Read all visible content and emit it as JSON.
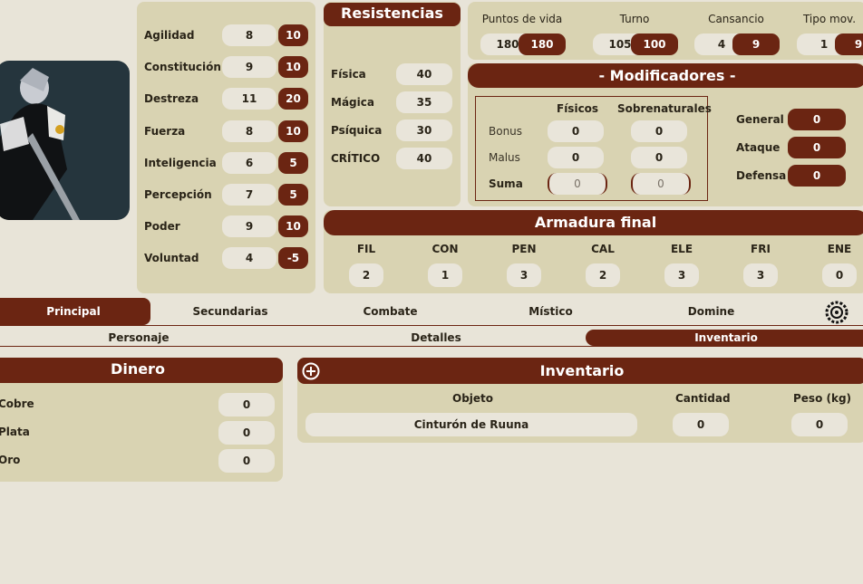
{
  "stats": [
    {
      "name": "Agilidad",
      "base": "8",
      "value": "10"
    },
    {
      "name": "Constitución",
      "base": "9",
      "value": "10"
    },
    {
      "name": "Destreza",
      "base": "11",
      "value": "20"
    },
    {
      "name": "Fuerza",
      "base": "8",
      "value": "10"
    },
    {
      "name": "Inteligencia",
      "base": "6",
      "value": "5"
    },
    {
      "name": "Percepción",
      "base": "7",
      "value": "5"
    },
    {
      "name": "Poder",
      "base": "9",
      "value": "10"
    },
    {
      "name": "Voluntad",
      "base": "4",
      "value": "-5"
    }
  ],
  "resistencias": {
    "title": "Resistencias",
    "items": [
      {
        "name": "Física",
        "value": "40"
      },
      {
        "name": "Mágica",
        "value": "35"
      },
      {
        "name": "Psíquica",
        "value": "30"
      },
      {
        "name": "CRÍTICO",
        "value": "40"
      }
    ]
  },
  "vitals": [
    {
      "label": "Puntos de vida",
      "current": "180",
      "max": "180"
    },
    {
      "label": "Turno",
      "current": "105",
      "max": "100"
    },
    {
      "label": "Cansancio",
      "current": "4",
      "max": "9"
    },
    {
      "label": "Tipo mov.",
      "current": "1",
      "max": "9"
    }
  ],
  "modificadores": {
    "title": "- Modificadores -",
    "col1": "Físicos",
    "col2": "Sobrenaturales",
    "rows": [
      {
        "label": "Bonus",
        "fis": "0",
        "sob": "0"
      },
      {
        "label": "Malus",
        "fis": "0",
        "sob": "0"
      },
      {
        "label": "Suma",
        "fis": "0",
        "sob": "0"
      }
    ],
    "side": [
      {
        "label": "General",
        "value": "0"
      },
      {
        "label": "Ataque",
        "value": "0"
      },
      {
        "label": "Defensa",
        "value": "0"
      }
    ]
  },
  "armadura": {
    "title": "Armadura final",
    "items": [
      {
        "label": "FIL",
        "value": "2"
      },
      {
        "label": "CON",
        "value": "1"
      },
      {
        "label": "PEN",
        "value": "3"
      },
      {
        "label": "CAL",
        "value": "2"
      },
      {
        "label": "ELE",
        "value": "3"
      },
      {
        "label": "FRI",
        "value": "3"
      },
      {
        "label": "ENE",
        "value": "0"
      }
    ]
  },
  "tabs": [
    "Principal",
    "Secundarias",
    "Combate",
    "Místico",
    "Domine"
  ],
  "subtabs": [
    "Personaje",
    "Detalles",
    "Inventario"
  ],
  "dinero": {
    "title": "Dinero",
    "items": [
      {
        "label": "Cobre",
        "value": "0"
      },
      {
        "label": "Plata",
        "value": "0"
      },
      {
        "label": "Oro",
        "value": "0"
      }
    ]
  },
  "inventario": {
    "title": "Inventario",
    "col_obj": "Objeto",
    "col_cant": "Cantidad",
    "col_peso": "Peso (kg)",
    "items": [
      {
        "name": "Cinturón de Ruuna",
        "cantidad": "0",
        "peso": "0"
      }
    ]
  },
  "icons": {
    "add": "plus-circle-icon",
    "settings": "gear-icon"
  }
}
